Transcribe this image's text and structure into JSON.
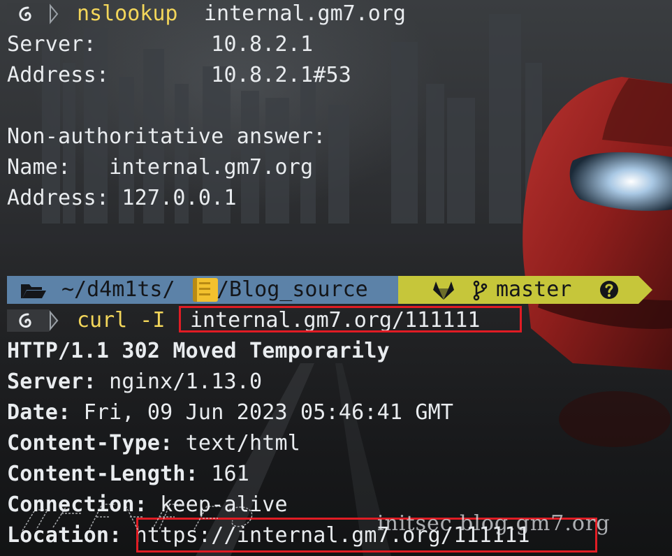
{
  "terminal": {
    "session1": {
      "command": "nslookup",
      "argument": "internal.gm7.org",
      "output": [
        "Server:         10.8.2.1",
        "Address:        10.8.2.1#53",
        "",
        "Non-authoritative answer:",
        "Name:   internal.gm7.org",
        "Address: 127.0.0.1"
      ]
    },
    "powerline": {
      "path_prefix": "~/d4m1ts/",
      "path_suffix": "/Blog_source",
      "branch": "master"
    },
    "session2": {
      "command": "curl -I",
      "argument": "internal.gm7.org/111111",
      "headers": [
        {
          "key": "HTTP/1.1 302 Moved Temporarily",
          "value": ""
        },
        {
          "key": "Server:",
          "value": " nginx/1.13.0"
        },
        {
          "key": "Date:",
          "value": " Fri, 09 Jun 2023 05:46:41 GMT"
        },
        {
          "key": "Content-Type:",
          "value": " text/html"
        },
        {
          "key": "Content-Length:",
          "value": " 161"
        },
        {
          "key": "Connection:",
          "value": " keep-alive"
        },
        {
          "key": "Location:",
          "value": " https://internal.gm7.org/111111"
        }
      ]
    }
  },
  "watermark": "initsec blog.gm7.org",
  "icons": {
    "prompt": "debian-swirl-icon",
    "folder": "folder-open-icon",
    "notebook": "notebook-emoji-icon",
    "gitlab": "gitlab-icon",
    "branch": "git-branch-icon",
    "status": "question-circle-icon"
  },
  "colors": {
    "command": "#f3d65a",
    "text": "#e9ecef",
    "dir_segment": "#5c82a8",
    "git_segment": "#c6c63a",
    "highlight": "#e01c24"
  }
}
